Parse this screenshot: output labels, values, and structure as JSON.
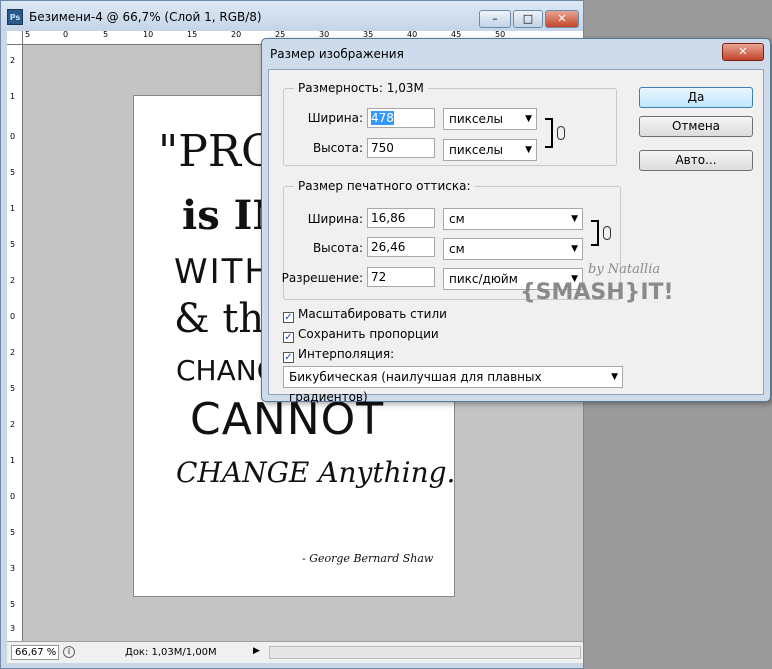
{
  "document": {
    "app_icon": "Ps",
    "title": "Безимени-4 @ 66,7% (Слой 1, RGB/8)",
    "buttons": {
      "minimize": "–",
      "maximize": "□",
      "close": "✕"
    },
    "ruler_top_ticks": [
      "5",
      "0",
      "5",
      "10",
      "15",
      "20",
      "25",
      "30",
      "35",
      "40",
      "45",
      "50"
    ],
    "ruler_left_ticks": [
      "2",
      "1",
      "0",
      "5",
      "1",
      "5",
      "2",
      "0",
      "2",
      "5",
      "2",
      "1",
      "0",
      "5",
      "3",
      "5",
      "3"
    ],
    "poster_lines": [
      "\"PRO",
      "is IN",
      "WITH",
      "& tha",
      "CHANGE",
      "CANNOT",
      "CHANGE Anything.\"",
      "- George Bernard Shaw"
    ]
  },
  "statusbar": {
    "zoom": "66,67 %",
    "doc_info": "Док: 1,03M/1,00M",
    "arrow": "▶"
  },
  "dialog": {
    "title": "Размер изображения",
    "close_label": "✕",
    "pixel_dimensions": {
      "label": "Размерность:",
      "value": "1,03M",
      "width_label": "Ширина:",
      "width_value": "478",
      "width_unit": "пикселы",
      "height_label": "Высота:",
      "height_value": "750",
      "height_unit": "пикселы"
    },
    "document_size": {
      "label": "Размер печатного оттиска:",
      "width_label": "Ширина:",
      "width_value": "16,86",
      "width_unit": "см",
      "height_label": "Высота:",
      "height_value": "26,46",
      "height_unit": "см",
      "resolution_label": "Разрешение:",
      "resolution_value": "72",
      "resolution_unit": "пикс/дюйм"
    },
    "checkboxes": [
      {
        "label": "Масштабировать стили",
        "checked": true
      },
      {
        "label": "Сохранить пропорции",
        "checked": true
      },
      {
        "label": "Интерполяция:",
        "checked": true
      }
    ],
    "interpolation": "Бикубическая (наилучшая для плавных градиентов)",
    "buttons": {
      "ok": "Да",
      "cancel": "Отмена",
      "auto": "Авто..."
    },
    "chain_icon": "8",
    "dropdown_arrow": "▼",
    "check_mark": "✓"
  },
  "watermark": {
    "byline": "by Natallia",
    "brand": "{SMASH}IT!"
  },
  "colors": {
    "title_bar": "#c9d7e6",
    "dialog_bg": "#f0f0f0",
    "canvas_bg": "#c4c4c4",
    "workspace_bg": "#9b9b9b",
    "selection": "#3399ff",
    "close_button": "#c1452a"
  }
}
